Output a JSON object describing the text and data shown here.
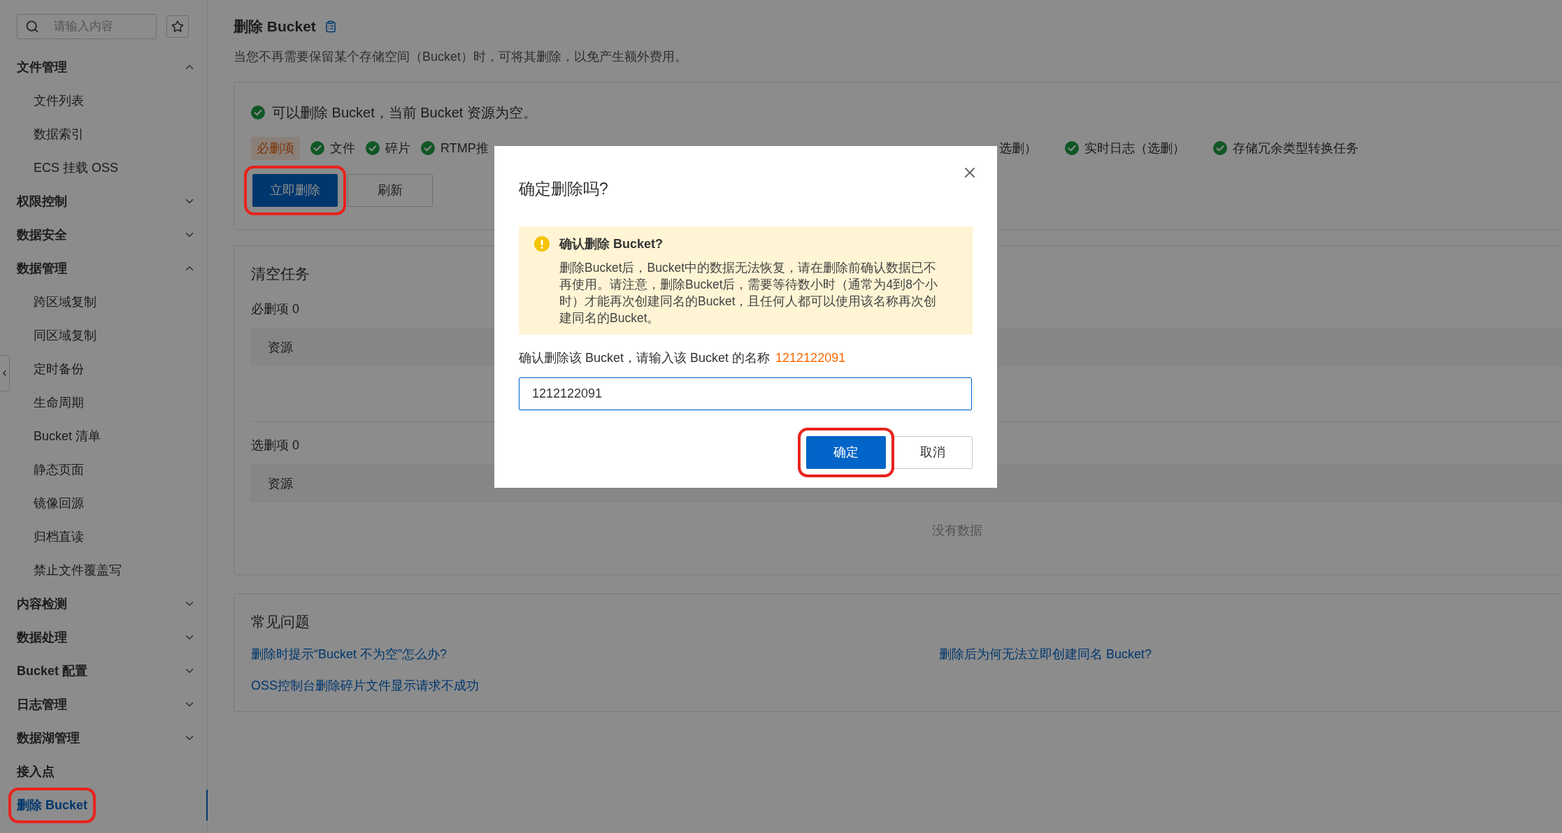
{
  "search": {
    "placeholder": "请输入内容"
  },
  "sidebar": {
    "items": [
      {
        "kind": "group",
        "label": "文件管理",
        "expanded": true,
        "children": [
          {
            "label": "文件列表",
            "selected": false
          },
          {
            "label": "数据索引",
            "selected": false
          },
          {
            "label": "ECS 挂载 OSS",
            "selected": false
          }
        ]
      },
      {
        "kind": "group",
        "label": "权限控制",
        "expanded": false
      },
      {
        "kind": "group",
        "label": "数据安全",
        "expanded": false
      },
      {
        "kind": "group",
        "label": "数据管理",
        "expanded": true,
        "children": [
          {
            "label": "跨区域复制",
            "selected": false
          },
          {
            "label": "同区域复制",
            "selected": false
          },
          {
            "label": "定时备份",
            "selected": false
          },
          {
            "label": "生命周期",
            "selected": false
          },
          {
            "label": "Bucket 清单",
            "selected": false
          },
          {
            "label": "静态页面",
            "selected": false
          },
          {
            "label": "镜像回源",
            "selected": false
          },
          {
            "label": "归档直读",
            "selected": false
          },
          {
            "label": "禁止文件覆盖写",
            "selected": false
          }
        ]
      },
      {
        "kind": "group",
        "label": "内容检测",
        "expanded": false
      },
      {
        "kind": "group",
        "label": "数据处理",
        "expanded": false
      },
      {
        "kind": "group",
        "label": "Bucket 配置",
        "expanded": false
      },
      {
        "kind": "group",
        "label": "日志管理",
        "expanded": false
      },
      {
        "kind": "group",
        "label": "数据湖管理",
        "expanded": false
      },
      {
        "kind": "link",
        "label": "接入点",
        "selected": false,
        "annotated": false
      },
      {
        "kind": "link",
        "label": "删除 Bucket",
        "selected": true,
        "annotated": true
      }
    ]
  },
  "page": {
    "title": "删除 Bucket",
    "description": "当您不再需要保留某个存储空间（Bucket）时，可将其删除，以免产生额外费用。"
  },
  "status": {
    "text": "可以删除 Bucket，当前 Bucket 资源为空。"
  },
  "checklist": {
    "left": [
      {
        "kind": "tag",
        "label": "必删项"
      },
      {
        "kind": "check",
        "label": "文件"
      },
      {
        "kind": "check",
        "label": "碎片"
      },
      {
        "kind": "check",
        "label": "RTMP推"
      }
    ],
    "right": [
      {
        "kind": "text",
        "label": "选删）"
      },
      {
        "kind": "check",
        "label": "实时日志（选删）"
      },
      {
        "kind": "check",
        "label": "存储冗余类型转换任务"
      }
    ]
  },
  "actions": [
    {
      "kind": "primary",
      "label": "立即删除",
      "annotated": true
    },
    {
      "kind": "secondary",
      "label": "刷新",
      "annotated": false
    }
  ],
  "cleanup": {
    "title": "清空任务",
    "sections": [
      {
        "label": "必删项 0",
        "columns": [
          "资源"
        ]
      },
      {
        "label": "选删项 0",
        "columns": [
          "资源"
        ],
        "empty_text": "没有数据"
      }
    ]
  },
  "faq": {
    "title": "常见问题",
    "links": [
      "删除时提示“Bucket 不为空”怎么办?",
      "删除后为何无法立即创建同名 Bucket?",
      "OSS控制台删除碎片文件显示请求不成功"
    ]
  },
  "dialog": {
    "title": "确定删除吗?",
    "alert": {
      "title": "确认删除 Bucket?",
      "body": "删除Bucket后，Bucket中的数据无法恢复，请在删除前确认数据已不再使用。请注意，删除Bucket后，需要等待数小时（通常为4到8个小时）才能再次创建同名的Bucket，且任何人都可以使用该名称再次创建同名的Bucket。"
    },
    "prompt": "确认删除该 Bucket，请输入该 Bucket 的名称",
    "bucket_name": "1212122091",
    "input_value": "1212122091",
    "buttons": [
      {
        "kind": "primary",
        "label": "确定",
        "annotated": true
      },
      {
        "kind": "secondary",
        "label": "取消",
        "annotated": false
      }
    ]
  }
}
